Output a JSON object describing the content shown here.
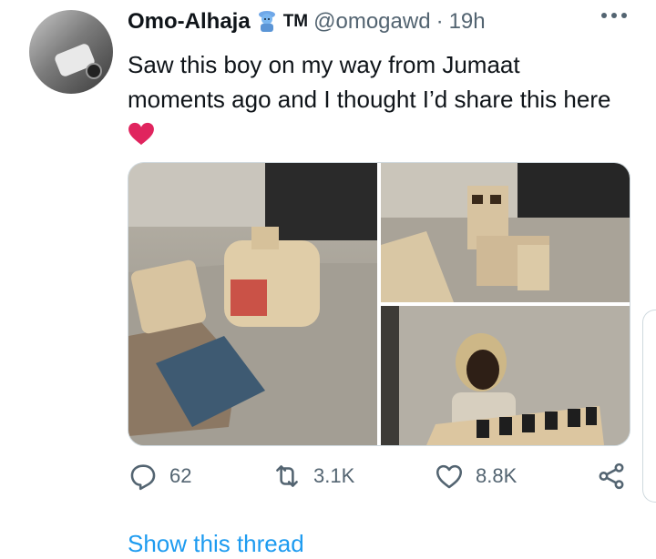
{
  "tweet": {
    "author_name": "Omo-Alhaja",
    "author_badge": "TM",
    "handle": "@omogawd",
    "separator": "·",
    "time": "19h",
    "text": "Saw this boy on my way from Jumaat moments ago and I thought I’d share this here",
    "emoji_after_name": "genie-emoji",
    "emoji_after_text": "red-heart-emoji"
  },
  "media": {
    "photos": [
      {
        "name": "photo-toy-vehicles"
      },
      {
        "name": "photo-toy-truck"
      },
      {
        "name": "photo-boy-with-toy-bus"
      }
    ]
  },
  "actions": {
    "replies": "62",
    "retweets": "3.1K",
    "likes": "8.8K"
  },
  "footer": {
    "show_thread": "Show this thread"
  },
  "colors": {
    "text": "#0f1419",
    "secondary": "#536471",
    "link": "#1d9bf0",
    "heart": "#e0245e"
  }
}
